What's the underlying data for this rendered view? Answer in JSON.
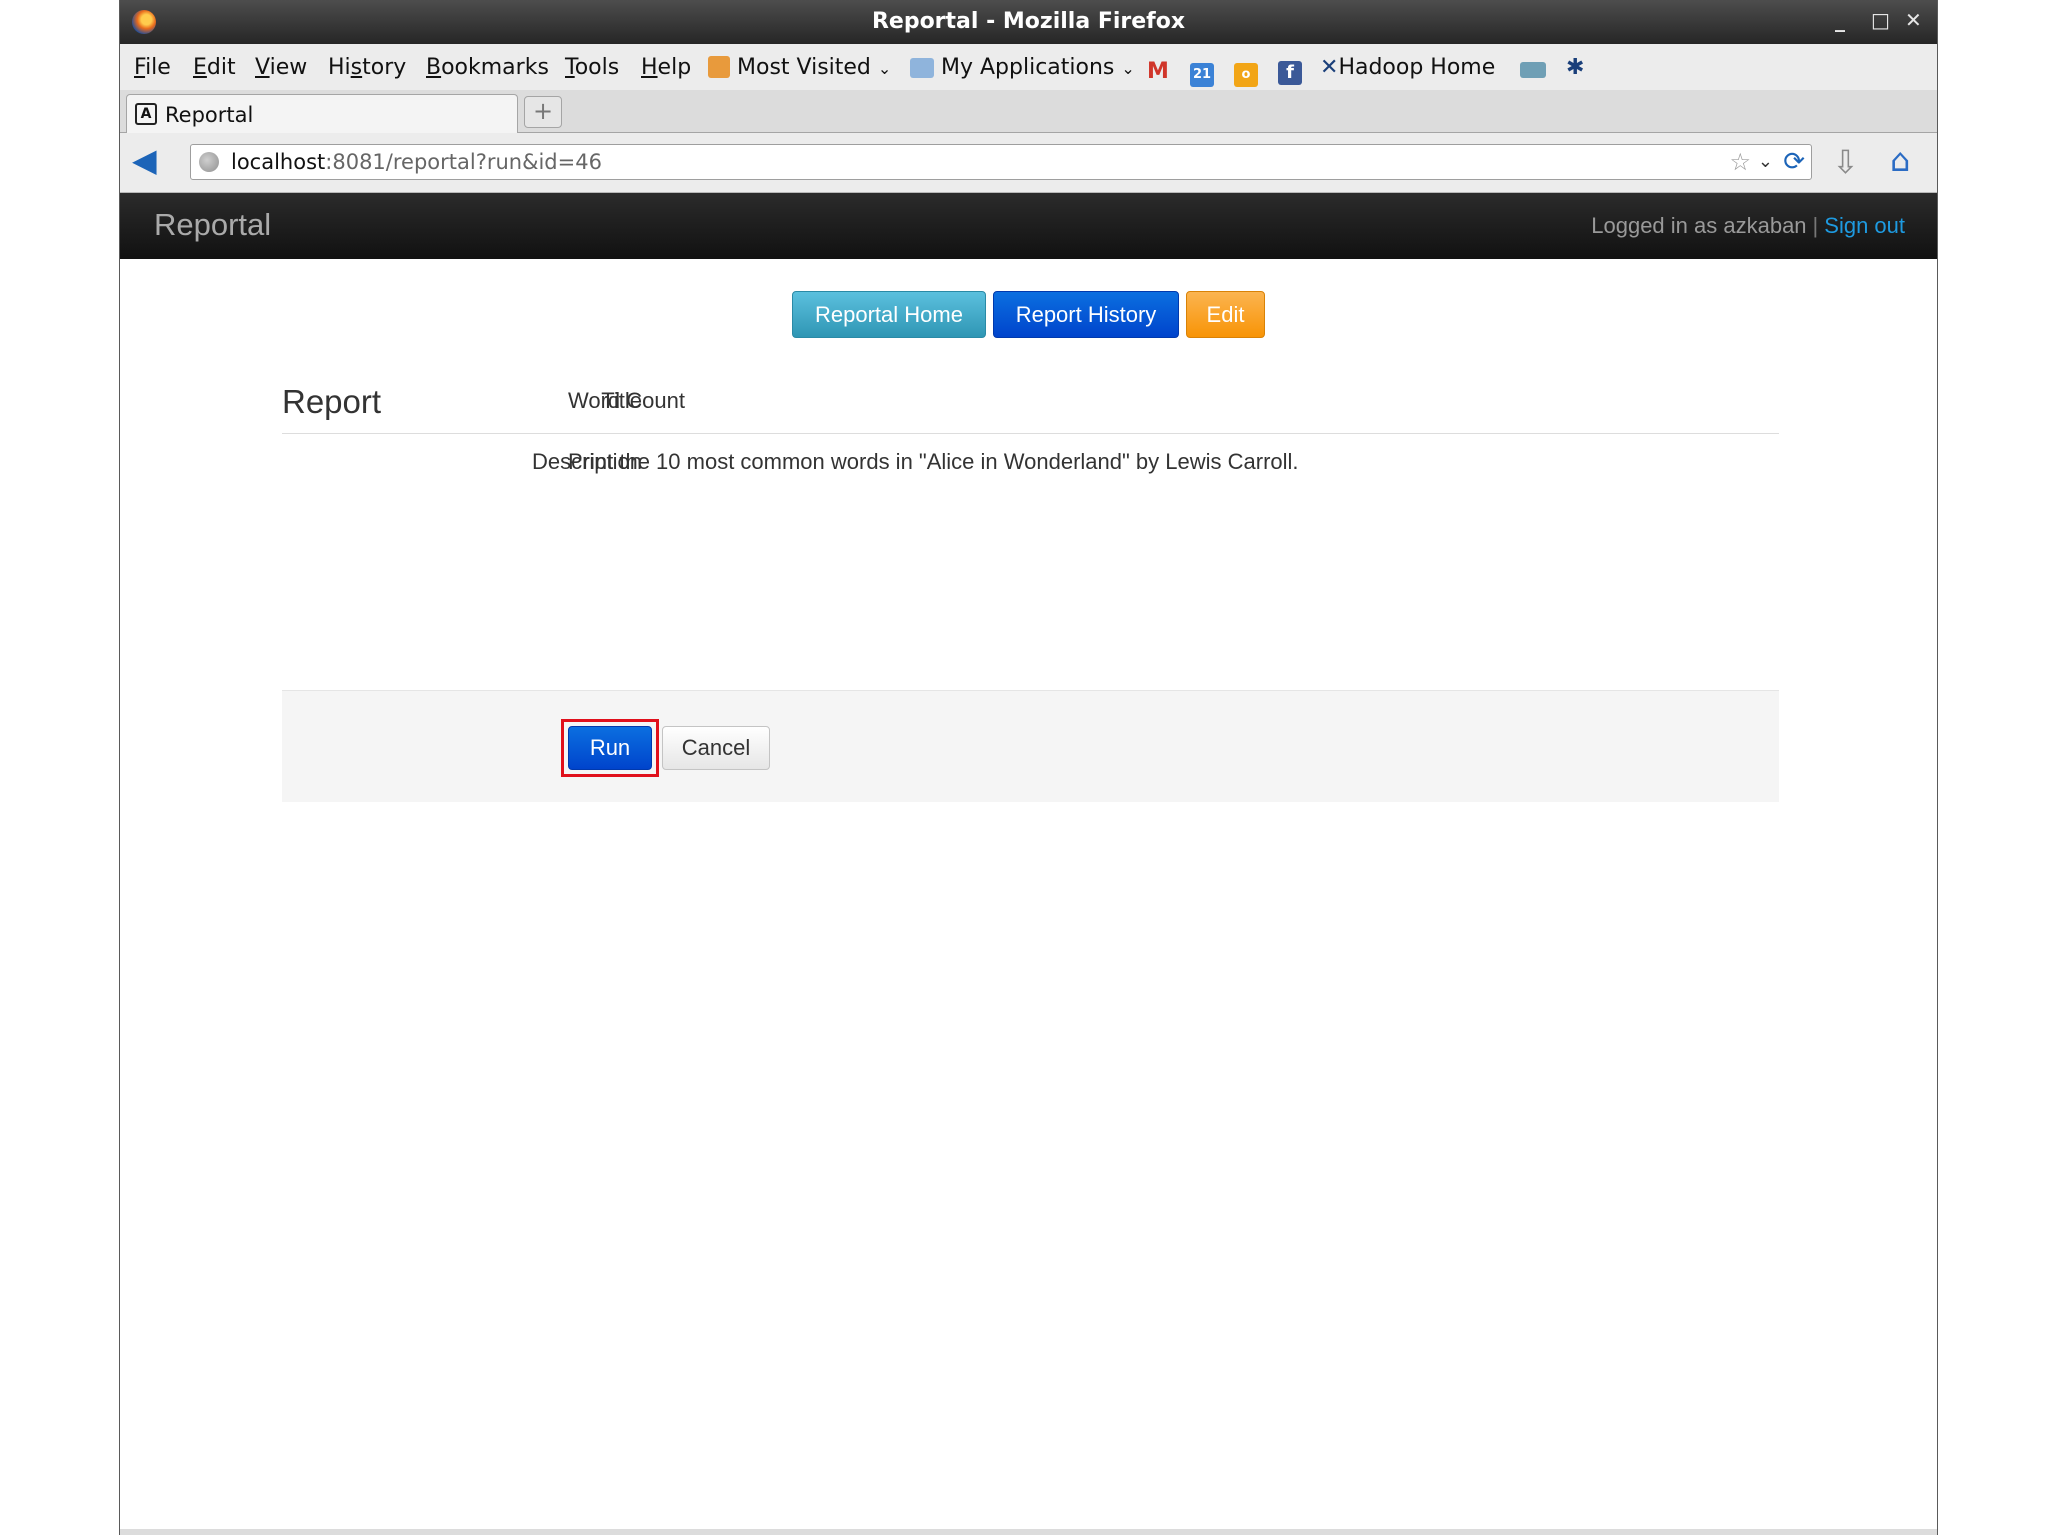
{
  "window": {
    "title": "Reportal - Mozilla Firefox",
    "controls": {
      "minimize": "_",
      "maximize": "□",
      "close": "✕"
    }
  },
  "menubar": {
    "items": [
      {
        "pre": "",
        "u": "F",
        "post": "ile"
      },
      {
        "pre": "",
        "u": "E",
        "post": "dit"
      },
      {
        "pre": "",
        "u": "V",
        "post": "iew"
      },
      {
        "pre": "Hi",
        "u": "s",
        "post": "tory"
      },
      {
        "pre": "",
        "u": "B",
        "post": "ookmarks"
      },
      {
        "pre": "",
        "u": "T",
        "post": "ools"
      },
      {
        "pre": "",
        "u": "H",
        "post": "elp"
      }
    ],
    "bookmarks": {
      "most_visited": "Most Visited",
      "my_applications": "My Applications",
      "calendar_day": "21",
      "hadoop_home": "Hadoop Home"
    }
  },
  "tabs": {
    "active_label": "Reportal",
    "new_tab_symbol": "+"
  },
  "navbar": {
    "url_host": "localhost",
    "url_path": ":8081/reportal?run&id=46"
  },
  "app": {
    "brand": "Reportal",
    "logged_in_text": "Logged in as azkaban",
    "separator": "|",
    "sign_out": "Sign out"
  },
  "buttons": {
    "reportal_home": "Reportal Home",
    "report_history": "Report History",
    "edit": "Edit"
  },
  "report": {
    "heading": "Report",
    "title_label": "Title",
    "title_value": "Word Count",
    "description_label": "Description",
    "description_value": "Print the 10 most common words in \"Alice in Wonderland\" by Lewis Carroll."
  },
  "actions": {
    "run": "Run",
    "cancel": "Cancel"
  },
  "colors": {
    "primary": "#0044cc",
    "info": "#2f96b4",
    "warning": "#f89406",
    "highlight": "#e0101c",
    "link": "#1e9ae0"
  }
}
